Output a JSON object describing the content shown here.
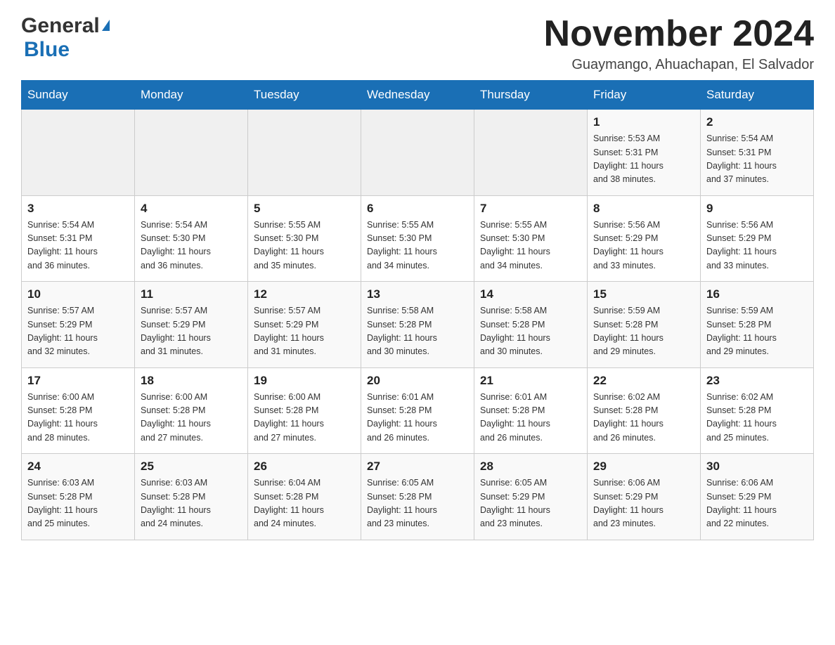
{
  "header": {
    "logo_line1": "General",
    "logo_triangle": "▲",
    "logo_line2": "Blue",
    "month_title": "November 2024",
    "location": "Guaymango, Ahuachapan, El Salvador"
  },
  "weekdays": [
    "Sunday",
    "Monday",
    "Tuesday",
    "Wednesday",
    "Thursday",
    "Friday",
    "Saturday"
  ],
  "weeks": [
    [
      {
        "day": "",
        "info": ""
      },
      {
        "day": "",
        "info": ""
      },
      {
        "day": "",
        "info": ""
      },
      {
        "day": "",
        "info": ""
      },
      {
        "day": "",
        "info": ""
      },
      {
        "day": "1",
        "info": "Sunrise: 5:53 AM\nSunset: 5:31 PM\nDaylight: 11 hours\nand 38 minutes."
      },
      {
        "day": "2",
        "info": "Sunrise: 5:54 AM\nSunset: 5:31 PM\nDaylight: 11 hours\nand 37 minutes."
      }
    ],
    [
      {
        "day": "3",
        "info": "Sunrise: 5:54 AM\nSunset: 5:31 PM\nDaylight: 11 hours\nand 36 minutes."
      },
      {
        "day": "4",
        "info": "Sunrise: 5:54 AM\nSunset: 5:30 PM\nDaylight: 11 hours\nand 36 minutes."
      },
      {
        "day": "5",
        "info": "Sunrise: 5:55 AM\nSunset: 5:30 PM\nDaylight: 11 hours\nand 35 minutes."
      },
      {
        "day": "6",
        "info": "Sunrise: 5:55 AM\nSunset: 5:30 PM\nDaylight: 11 hours\nand 34 minutes."
      },
      {
        "day": "7",
        "info": "Sunrise: 5:55 AM\nSunset: 5:30 PM\nDaylight: 11 hours\nand 34 minutes."
      },
      {
        "day": "8",
        "info": "Sunrise: 5:56 AM\nSunset: 5:29 PM\nDaylight: 11 hours\nand 33 minutes."
      },
      {
        "day": "9",
        "info": "Sunrise: 5:56 AM\nSunset: 5:29 PM\nDaylight: 11 hours\nand 33 minutes."
      }
    ],
    [
      {
        "day": "10",
        "info": "Sunrise: 5:57 AM\nSunset: 5:29 PM\nDaylight: 11 hours\nand 32 minutes."
      },
      {
        "day": "11",
        "info": "Sunrise: 5:57 AM\nSunset: 5:29 PM\nDaylight: 11 hours\nand 31 minutes."
      },
      {
        "day": "12",
        "info": "Sunrise: 5:57 AM\nSunset: 5:29 PM\nDaylight: 11 hours\nand 31 minutes."
      },
      {
        "day": "13",
        "info": "Sunrise: 5:58 AM\nSunset: 5:28 PM\nDaylight: 11 hours\nand 30 minutes."
      },
      {
        "day": "14",
        "info": "Sunrise: 5:58 AM\nSunset: 5:28 PM\nDaylight: 11 hours\nand 30 minutes."
      },
      {
        "day": "15",
        "info": "Sunrise: 5:59 AM\nSunset: 5:28 PM\nDaylight: 11 hours\nand 29 minutes."
      },
      {
        "day": "16",
        "info": "Sunrise: 5:59 AM\nSunset: 5:28 PM\nDaylight: 11 hours\nand 29 minutes."
      }
    ],
    [
      {
        "day": "17",
        "info": "Sunrise: 6:00 AM\nSunset: 5:28 PM\nDaylight: 11 hours\nand 28 minutes."
      },
      {
        "day": "18",
        "info": "Sunrise: 6:00 AM\nSunset: 5:28 PM\nDaylight: 11 hours\nand 27 minutes."
      },
      {
        "day": "19",
        "info": "Sunrise: 6:00 AM\nSunset: 5:28 PM\nDaylight: 11 hours\nand 27 minutes."
      },
      {
        "day": "20",
        "info": "Sunrise: 6:01 AM\nSunset: 5:28 PM\nDaylight: 11 hours\nand 26 minutes."
      },
      {
        "day": "21",
        "info": "Sunrise: 6:01 AM\nSunset: 5:28 PM\nDaylight: 11 hours\nand 26 minutes."
      },
      {
        "day": "22",
        "info": "Sunrise: 6:02 AM\nSunset: 5:28 PM\nDaylight: 11 hours\nand 26 minutes."
      },
      {
        "day": "23",
        "info": "Sunrise: 6:02 AM\nSunset: 5:28 PM\nDaylight: 11 hours\nand 25 minutes."
      }
    ],
    [
      {
        "day": "24",
        "info": "Sunrise: 6:03 AM\nSunset: 5:28 PM\nDaylight: 11 hours\nand 25 minutes."
      },
      {
        "day": "25",
        "info": "Sunrise: 6:03 AM\nSunset: 5:28 PM\nDaylight: 11 hours\nand 24 minutes."
      },
      {
        "day": "26",
        "info": "Sunrise: 6:04 AM\nSunset: 5:28 PM\nDaylight: 11 hours\nand 24 minutes."
      },
      {
        "day": "27",
        "info": "Sunrise: 6:05 AM\nSunset: 5:28 PM\nDaylight: 11 hours\nand 23 minutes."
      },
      {
        "day": "28",
        "info": "Sunrise: 6:05 AM\nSunset: 5:29 PM\nDaylight: 11 hours\nand 23 minutes."
      },
      {
        "day": "29",
        "info": "Sunrise: 6:06 AM\nSunset: 5:29 PM\nDaylight: 11 hours\nand 23 minutes."
      },
      {
        "day": "30",
        "info": "Sunrise: 6:06 AM\nSunset: 5:29 PM\nDaylight: 11 hours\nand 22 minutes."
      }
    ]
  ]
}
